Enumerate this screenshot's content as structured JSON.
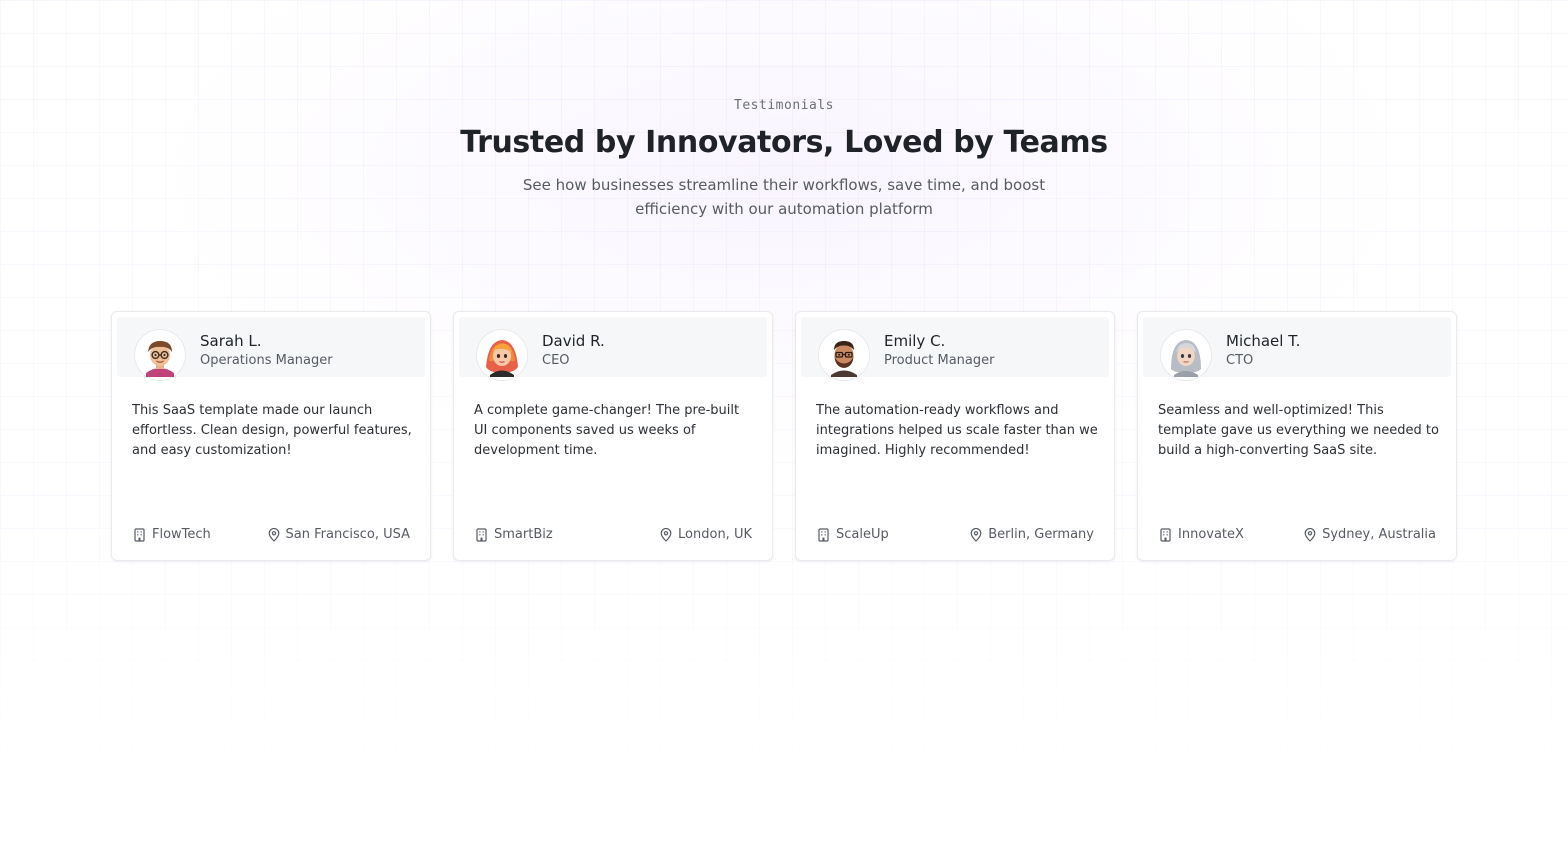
{
  "section": {
    "eyebrow": "Testimonials",
    "title": "Trusted by Innovators, Loved by Teams",
    "subtitle": "See how businesses streamline their workflows, save time, and boost efficiency with our automation platform"
  },
  "testimonials": [
    {
      "name": "Sarah L.",
      "role": "Operations Manager",
      "avatar_icon": "avatar-glasses-icon",
      "quote": "This SaaS template made our launch effortless. Clean design, powerful features, and easy customization!",
      "company": "FlowTech",
      "location": "San Francisco, USA"
    },
    {
      "name": "David R.",
      "role": "CEO",
      "avatar_icon": "avatar-red-hair-icon",
      "quote": "A complete game-changer! The pre-built UI components saved us weeks of development time.",
      "company": "SmartBiz",
      "location": "London, UK"
    },
    {
      "name": "Emily C.",
      "role": "Product Manager",
      "avatar_icon": "avatar-beard-icon",
      "quote": "The automation-ready workflows and integrations helped us scale faster than we imagined. Highly recommended!",
      "company": "ScaleUp",
      "location": "Berlin, Germany"
    },
    {
      "name": "Michael T.",
      "role": "CTO",
      "avatar_icon": "avatar-gray-hair-icon",
      "quote": "Seamless and well-optimized! This template gave us everything we needed to build a high-converting SaaS site.",
      "company": "InnovateX",
      "location": "Sydney, Australia"
    }
  ],
  "icons": {
    "company": "building-icon",
    "location": "map-pin-icon"
  },
  "colors": {
    "text_primary": "#1f2328",
    "text_secondary": "#565b63",
    "card_header_bg": "#f6f7f9",
    "card_border": "#e9eaee"
  }
}
